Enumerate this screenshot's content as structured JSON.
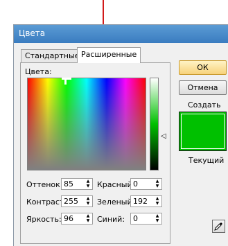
{
  "dialog": {
    "title": "Цвета",
    "tabs": [
      {
        "label": "Стандартные",
        "active": false
      },
      {
        "label": "Расширенные",
        "active": true
      }
    ],
    "colors_label": "Цвета:",
    "fields": {
      "hue": {
        "label": "Оттенок:",
        "value": "85"
      },
      "saturation": {
        "label": "Контраст:",
        "value": "255"
      },
      "brightness": {
        "label": "Яркость:",
        "value": "96"
      },
      "red": {
        "label": "Красный:",
        "value": "0"
      },
      "green": {
        "label": "Зеленый:",
        "value": "192"
      },
      "blue": {
        "label": "Синий:",
        "value": "0"
      }
    },
    "buttons": {
      "ok": "ОК",
      "cancel": "Отмена"
    },
    "create_label": "Создать",
    "current_label": "Текущий",
    "current_color": "#00c000",
    "accent_color": "#d11a1a"
  }
}
